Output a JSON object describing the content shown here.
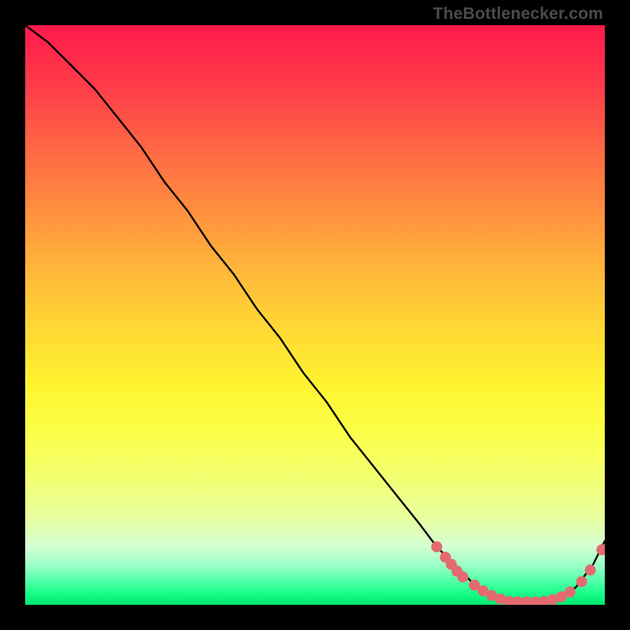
{
  "watermark": "TheBottlenecker.com",
  "chart_data": {
    "type": "line",
    "title": "",
    "xlabel": "",
    "ylabel": "",
    "xlim": [
      0,
      100
    ],
    "ylim": [
      0,
      100
    ],
    "grid": false,
    "legend": false,
    "series": [
      {
        "name": "bottleneck-curve",
        "x": [
          0,
          4,
          8,
          12,
          16,
          20,
          24,
          28,
          32,
          36,
          40,
          44,
          48,
          52,
          56,
          60,
          64,
          68,
          71,
          74,
          77,
          80,
          83,
          86,
          89,
          92,
          95,
          98,
          100
        ],
        "y": [
          100,
          97,
          93,
          89,
          84,
          79,
          73,
          68,
          62,
          57,
          51,
          46,
          40,
          35,
          29,
          24,
          19,
          14,
          10,
          7,
          4,
          2,
          1,
          0.5,
          0.5,
          1,
          3,
          7,
          11
        ],
        "color": "#000000"
      }
    ],
    "markers": [
      {
        "x": 71.0,
        "y": 10.0
      },
      {
        "x": 72.5,
        "y": 8.2
      },
      {
        "x": 73.5,
        "y": 7.0
      },
      {
        "x": 74.5,
        "y": 5.8
      },
      {
        "x": 75.5,
        "y": 4.8
      },
      {
        "x": 77.5,
        "y": 3.4
      },
      {
        "x": 79.0,
        "y": 2.4
      },
      {
        "x": 80.5,
        "y": 1.6
      },
      {
        "x": 82.0,
        "y": 1.0
      },
      {
        "x": 83.5,
        "y": 0.6
      },
      {
        "x": 85.0,
        "y": 0.5
      },
      {
        "x": 86.5,
        "y": 0.5
      },
      {
        "x": 88.0,
        "y": 0.5
      },
      {
        "x": 89.5,
        "y": 0.6
      },
      {
        "x": 91.0,
        "y": 0.9
      },
      {
        "x": 92.5,
        "y": 1.4
      },
      {
        "x": 94.0,
        "y": 2.2
      },
      {
        "x": 96.0,
        "y": 4.0
      },
      {
        "x": 97.5,
        "y": 6.0
      },
      {
        "x": 99.5,
        "y": 9.5
      }
    ],
    "marker_color": "#e46a6f",
    "marker_radius": 7
  }
}
